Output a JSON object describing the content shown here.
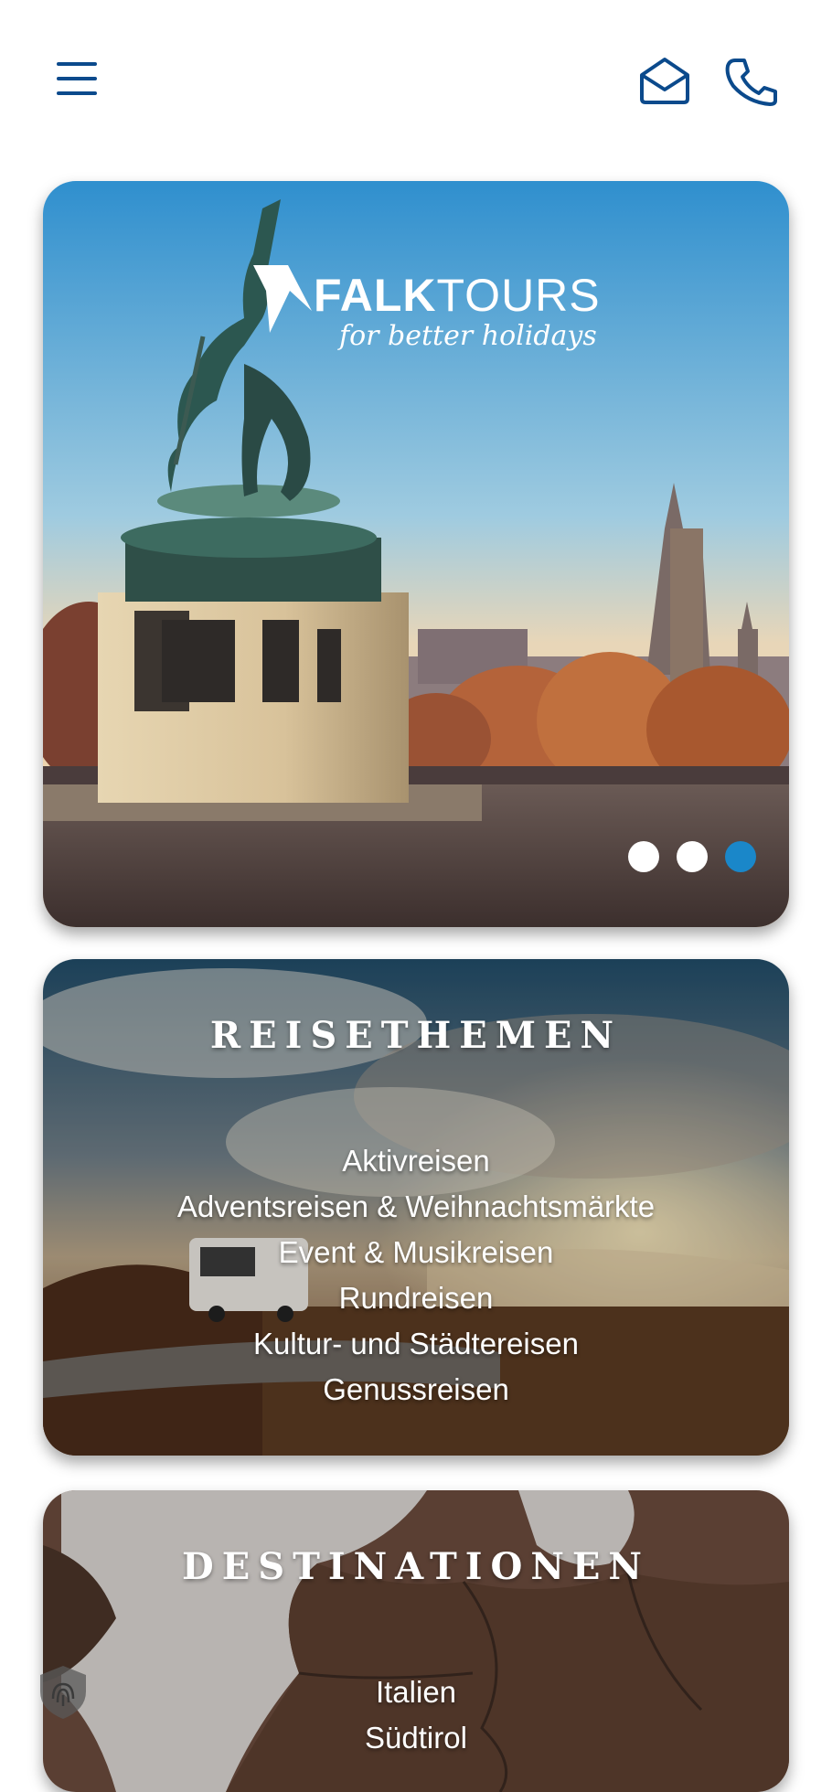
{
  "header": {
    "menu_icon": "hamburger-menu-icon",
    "mail_icon": "envelope-open-icon",
    "phone_icon": "phone-icon",
    "icon_color": "#0b4a8c"
  },
  "hero": {
    "logo_brand_bold": "FALK",
    "logo_brand_light": "TOURS",
    "logo_tagline": "for better holidays",
    "slides_total": 3,
    "active_slide": 3,
    "dot_active_color": "#1a87c9",
    "dot_inactive_color": "#ffffff"
  },
  "themes": {
    "title": "REISETHEMEN",
    "items": [
      "Aktivreisen",
      "Adventsreisen & Weihnachtsmärkte",
      "Event & Musikreisen",
      "Rundreisen",
      "Kultur- und Städtereisen",
      "Genussreisen"
    ]
  },
  "destinations": {
    "title": "DESTINATIONEN",
    "items": [
      "Italien",
      "Südtirol"
    ]
  },
  "privacy_badge_icon": "fingerprint-shield-icon"
}
